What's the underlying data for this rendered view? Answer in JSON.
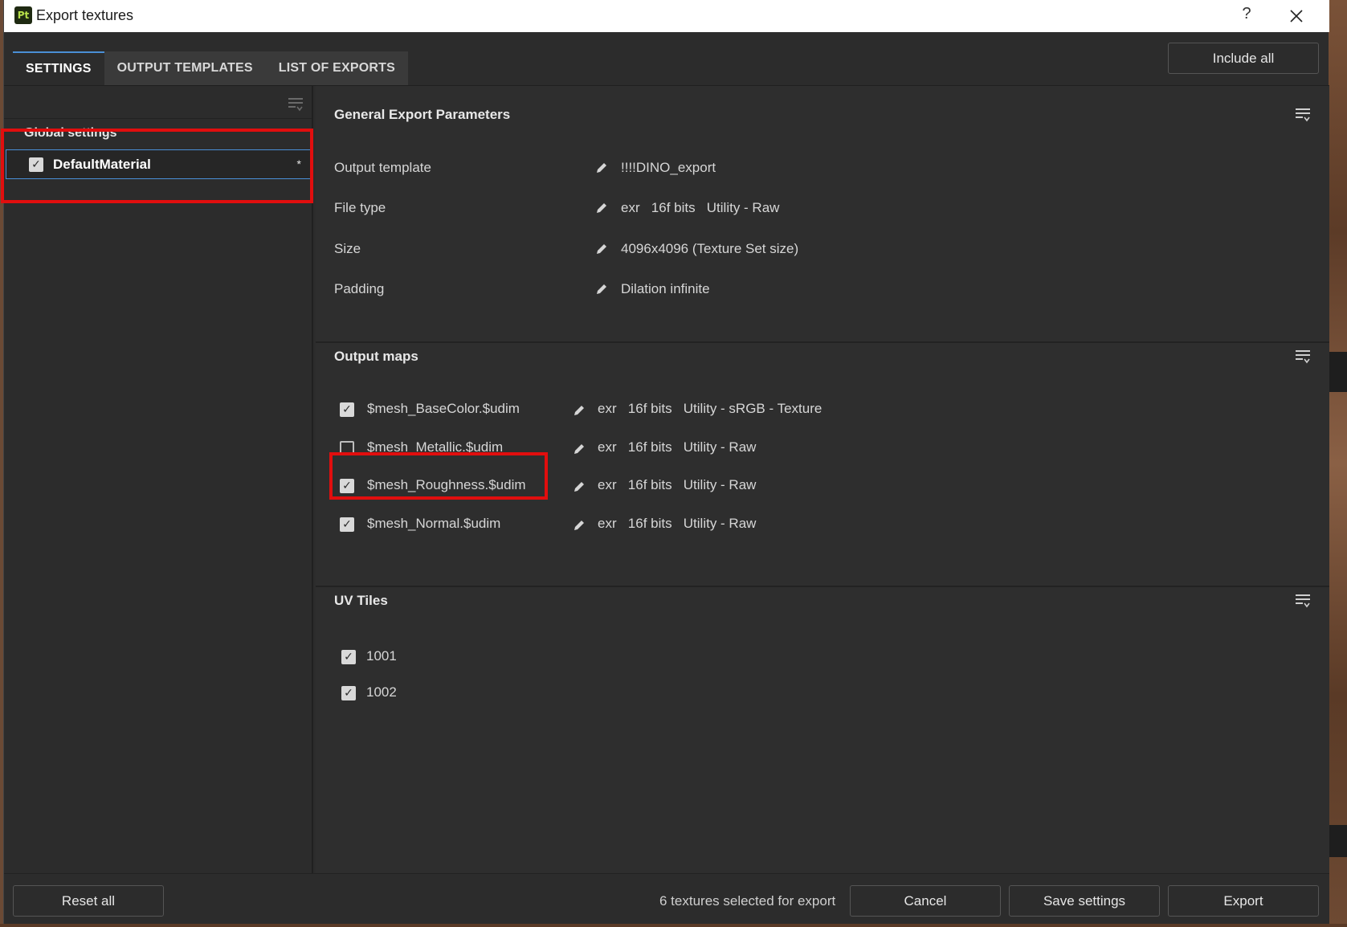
{
  "window": {
    "title": "Export textures",
    "app_icon_text": "Pt",
    "help_label": "?",
    "icons": {
      "app": "painter-app-icon",
      "close": "close-icon"
    }
  },
  "tabs": [
    {
      "label": "SETTINGS",
      "active": true
    },
    {
      "label": "OUTPUT TEMPLATES",
      "active": false
    },
    {
      "label": "LIST OF EXPORTS",
      "active": false
    }
  ],
  "header": {
    "include_all_label": "Include all"
  },
  "left_panel": {
    "global_settings_label": "Global settings",
    "material": {
      "name": "DefaultMaterial",
      "checked": true,
      "asterisk": "*"
    }
  },
  "general": {
    "title": "General Export Parameters",
    "params": [
      {
        "label": "Output template",
        "value": "!!!!DINO_export"
      },
      {
        "label": "File type",
        "value": "exr   16f bits   Utility - Raw"
      },
      {
        "label": "Size",
        "value": "4096x4096 (Texture Set size)"
      },
      {
        "label": "Padding",
        "value": "Dilation infinite"
      }
    ]
  },
  "output_maps": {
    "title": "Output maps",
    "maps": [
      {
        "name": "$mesh_BaseColor.$udim",
        "checked": true,
        "format": "exr   16f bits   Utility - sRGB - Texture"
      },
      {
        "name": "$mesh_Metallic.$udim",
        "checked": false,
        "format": "exr   16f bits   Utility - Raw"
      },
      {
        "name": "$mesh_Roughness.$udim",
        "checked": true,
        "format": "exr   16f bits   Utility - Raw"
      },
      {
        "name": "$mesh_Normal.$udim",
        "checked": true,
        "format": "exr   16f bits   Utility - Raw"
      }
    ]
  },
  "uv_tiles": {
    "title": "UV Tiles",
    "tiles": [
      {
        "label": "1001",
        "checked": true
      },
      {
        "label": "1002",
        "checked": true
      }
    ]
  },
  "footer": {
    "reset_label": "Reset all",
    "status": "6 textures selected for export",
    "cancel_label": "Cancel",
    "save_label": "Save settings",
    "export_label": "Export"
  },
  "colors": {
    "accent": "#4a8fd6",
    "highlight_box": "#e10e0e",
    "panel_bg": "#2c2c2c"
  }
}
